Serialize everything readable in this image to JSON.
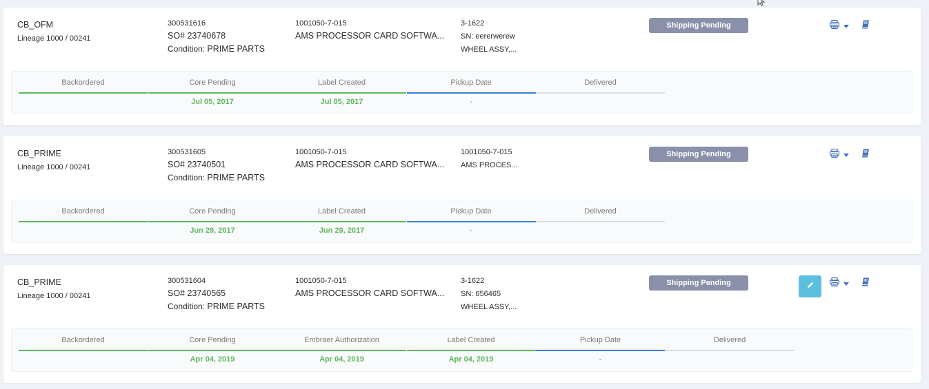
{
  "colors": {
    "done": "#5cb85c",
    "active": "#3b7fd9",
    "todo": "#dadde1",
    "badge": "#8a90aa",
    "edit": "#5bc0de",
    "icon": "#3f6fb6"
  },
  "icons": [
    "print-icon",
    "chevron-down-icon",
    "book-icon",
    "pencil-icon",
    "mouse-cursor-icon"
  ],
  "cards": [
    {
      "customer": "CB_OFM",
      "lineage": "Lineage 1000 / 00241",
      "order_id": "300531616",
      "so": "SO# 23740678",
      "condition_label": "Condition:",
      "condition_value": "PRIME PARTS",
      "part_number": "1001050-7-015",
      "part_desc": "AMS PROCESSOR CARD SOFTWA...",
      "serial_l1": "3-1622",
      "serial_l2": "SN: eererwerew",
      "serial_l3": "WHEEL ASSY,...",
      "status": "Shipping Pending",
      "has_edit": false,
      "steps": [
        {
          "label": "Backordered",
          "date": "",
          "state": "done"
        },
        {
          "label": "Core Pending",
          "date": "Jul 05, 2017",
          "state": "done"
        },
        {
          "label": "Label Created",
          "date": "Jul 05, 2017",
          "state": "done"
        },
        {
          "label": "Pickup Date",
          "date": "-",
          "state": "active"
        },
        {
          "label": "Delivered",
          "date": "",
          "state": "todo"
        }
      ]
    },
    {
      "customer": "CB_PRIME",
      "lineage": "Lineage 1000 / 00241",
      "order_id": "300531605",
      "so": "SO# 23740501",
      "condition_label": "Condition:",
      "condition_value": "PRIME PARTS",
      "part_number": "1001050-7-015",
      "part_desc": "AMS PROCESSOR CARD SOFTWA...",
      "serial_l1": "1001050-7-015",
      "serial_l2": "AMS PROCES...",
      "serial_l3": "",
      "status": "Shipping Pending",
      "has_edit": false,
      "steps": [
        {
          "label": "Backordered",
          "date": "",
          "state": "done"
        },
        {
          "label": "Core Pending",
          "date": "Jun 29, 2017",
          "state": "done"
        },
        {
          "label": "Label Created",
          "date": "Jun 29, 2017",
          "state": "done"
        },
        {
          "label": "Pickup Date",
          "date": "-",
          "state": "active"
        },
        {
          "label": "Delivered",
          "date": "",
          "state": "todo"
        }
      ]
    },
    {
      "customer": "CB_PRIME",
      "lineage": "Lineage 1000 / 00241",
      "order_id": "300531604",
      "so": "SO# 23740565",
      "condition_label": "Condition:",
      "condition_value": "PRIME PARTS",
      "part_number": "1001050-7-015",
      "part_desc": "AMS PROCESSOR CARD SOFTWA...",
      "serial_l1": "3-1622",
      "serial_l2": "SN: 656465",
      "serial_l3": "WHEEL ASSY,...",
      "status": "Shipping Pending",
      "has_edit": true,
      "steps": [
        {
          "label": "Backordered",
          "date": "",
          "state": "done"
        },
        {
          "label": "Core Pending",
          "date": "Apr 04, 2019",
          "state": "done"
        },
        {
          "label": "Embraer Authorization",
          "date": "Apr 04, 2019",
          "state": "done"
        },
        {
          "label": "Label Created",
          "date": "Apr 04, 2019",
          "state": "done"
        },
        {
          "label": "Pickup Date",
          "date": "-",
          "state": "active"
        },
        {
          "label": "Delivered",
          "date": "",
          "state": "todo"
        }
      ]
    }
  ]
}
